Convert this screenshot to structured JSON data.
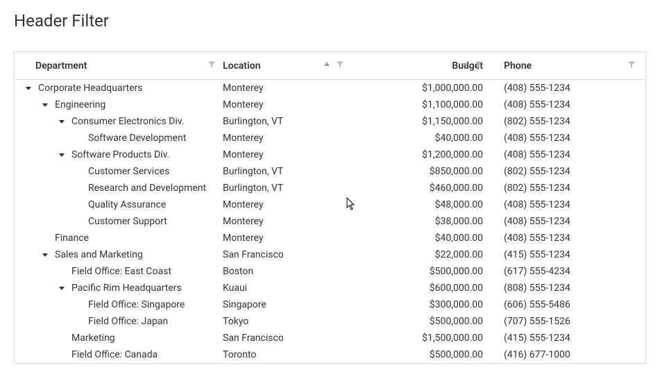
{
  "title": "Header Filter",
  "columns": {
    "department": {
      "label": "Department",
      "filterable": true
    },
    "location": {
      "label": "Location",
      "filterable": true,
      "sort": "asc"
    },
    "budget": {
      "label": "Budget",
      "filterable": true,
      "sort": "desc"
    },
    "phone": {
      "label": "Phone",
      "filterable": true
    }
  },
  "rows": [
    {
      "indent": 0,
      "expand": "open",
      "dept": "Corporate Headquarters",
      "loc": "Monterey",
      "bud": "$1,000,000.00",
      "phone": "(408) 555-1234"
    },
    {
      "indent": 1,
      "expand": "open",
      "dept": "Engineering",
      "loc": "Monterey",
      "bud": "$1,100,000.00",
      "phone": "(408) 555-1234"
    },
    {
      "indent": 2,
      "expand": "open",
      "dept": "Consumer Electronics Div.",
      "loc": "Burlington, VT",
      "bud": "$1,150,000.00",
      "phone": "(802) 555-1234"
    },
    {
      "indent": 3,
      "expand": "none",
      "dept": "Software Development",
      "loc": "Monterey",
      "bud": "$40,000.00",
      "phone": "(408) 555-1234"
    },
    {
      "indent": 2,
      "expand": "open",
      "dept": "Software Products Div.",
      "loc": "Monterey",
      "bud": "$1,200,000.00",
      "phone": "(408) 555-1234"
    },
    {
      "indent": 3,
      "expand": "none",
      "dept": "Customer Services",
      "loc": "Burlington, VT",
      "bud": "$850,000.00",
      "phone": "(802) 555-1234"
    },
    {
      "indent": 3,
      "expand": "none",
      "dept": "Research and Development",
      "loc": "Burlington, VT",
      "bud": "$460,000.00",
      "phone": "(802) 555-1234"
    },
    {
      "indent": 3,
      "expand": "none",
      "dept": "Quality Assurance",
      "loc": "Monterey",
      "bud": "$48,000.00",
      "phone": "(408) 555-1234"
    },
    {
      "indent": 3,
      "expand": "none",
      "dept": "Customer Support",
      "loc": "Monterey",
      "bud": "$38,000.00",
      "phone": "(408) 555-1234"
    },
    {
      "indent": 1,
      "expand": "none",
      "dept": "Finance",
      "loc": "Monterey",
      "bud": "$40,000.00",
      "phone": "(408) 555-1234"
    },
    {
      "indent": 1,
      "expand": "open",
      "dept": "Sales and Marketing",
      "loc": "San Francisco",
      "bud": "$22,000.00",
      "phone": "(415) 555-1234"
    },
    {
      "indent": 2,
      "expand": "none",
      "dept": "Field Office: East Coast",
      "loc": "Boston",
      "bud": "$500,000.00",
      "phone": "(617) 555-4234"
    },
    {
      "indent": 2,
      "expand": "open",
      "dept": "Pacific Rim Headquarters",
      "loc": "Kuaui",
      "bud": "$600,000.00",
      "phone": "(808) 555-1234"
    },
    {
      "indent": 3,
      "expand": "none",
      "dept": "Field Office: Singapore",
      "loc": "Singapore",
      "bud": "$300,000.00",
      "phone": "(606) 555-5486"
    },
    {
      "indent": 3,
      "expand": "none",
      "dept": "Field Office: Japan",
      "loc": "Tokyo",
      "bud": "$500,000.00",
      "phone": "(707) 555-1526"
    },
    {
      "indent": 2,
      "expand": "none",
      "dept": "Marketing",
      "loc": "San Francisco",
      "bud": "$1,500,000.00",
      "phone": "(415) 555-1234"
    },
    {
      "indent": 2,
      "expand": "none",
      "dept": "Field Office: Canada",
      "loc": "Toronto",
      "bud": "$500,000.00",
      "phone": "(416) 677-1000"
    }
  ]
}
